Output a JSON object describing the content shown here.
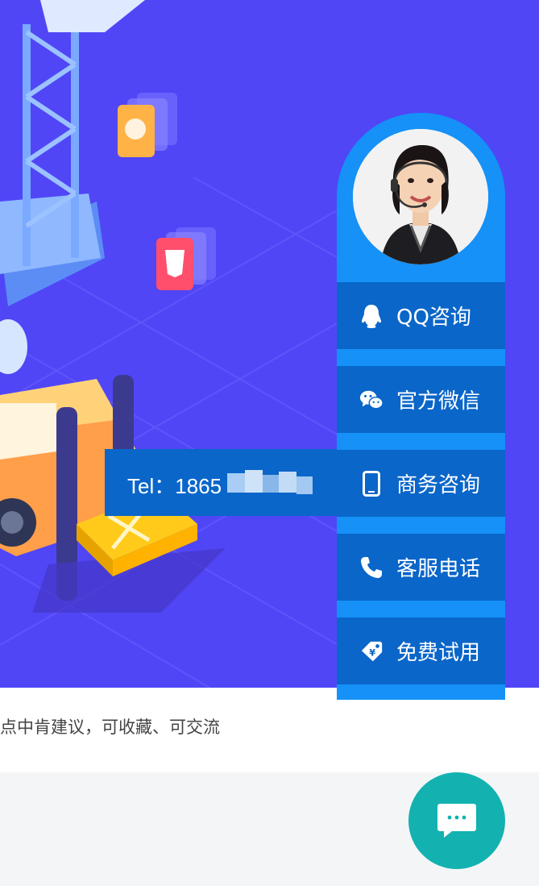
{
  "hero": {
    "illustration": "isometric-construction-crane-forklift",
    "background_color": "#5046f6"
  },
  "caption": "点中肯建议，可收藏、可交流",
  "service_panel": {
    "avatar": "customer-service-agent-photo",
    "items": [
      {
        "icon": "qq-penguin-icon",
        "label": "QQ咨询"
      },
      {
        "icon": "wechat-icon",
        "label": "官方微信"
      },
      {
        "icon": "mobile-phone-icon",
        "label": "商务咨询"
      },
      {
        "icon": "telephone-icon",
        "label": "客服电话"
      },
      {
        "icon": "price-tag-icon",
        "label": "免费试用"
      }
    ],
    "colors": {
      "panel": "#1591f7",
      "item": "#0a66c9"
    }
  },
  "tel_popup": {
    "text": "Tel：1865"
  },
  "chat_button": {
    "icon": "chat-bubble-icon",
    "color": "#13b2b0"
  }
}
